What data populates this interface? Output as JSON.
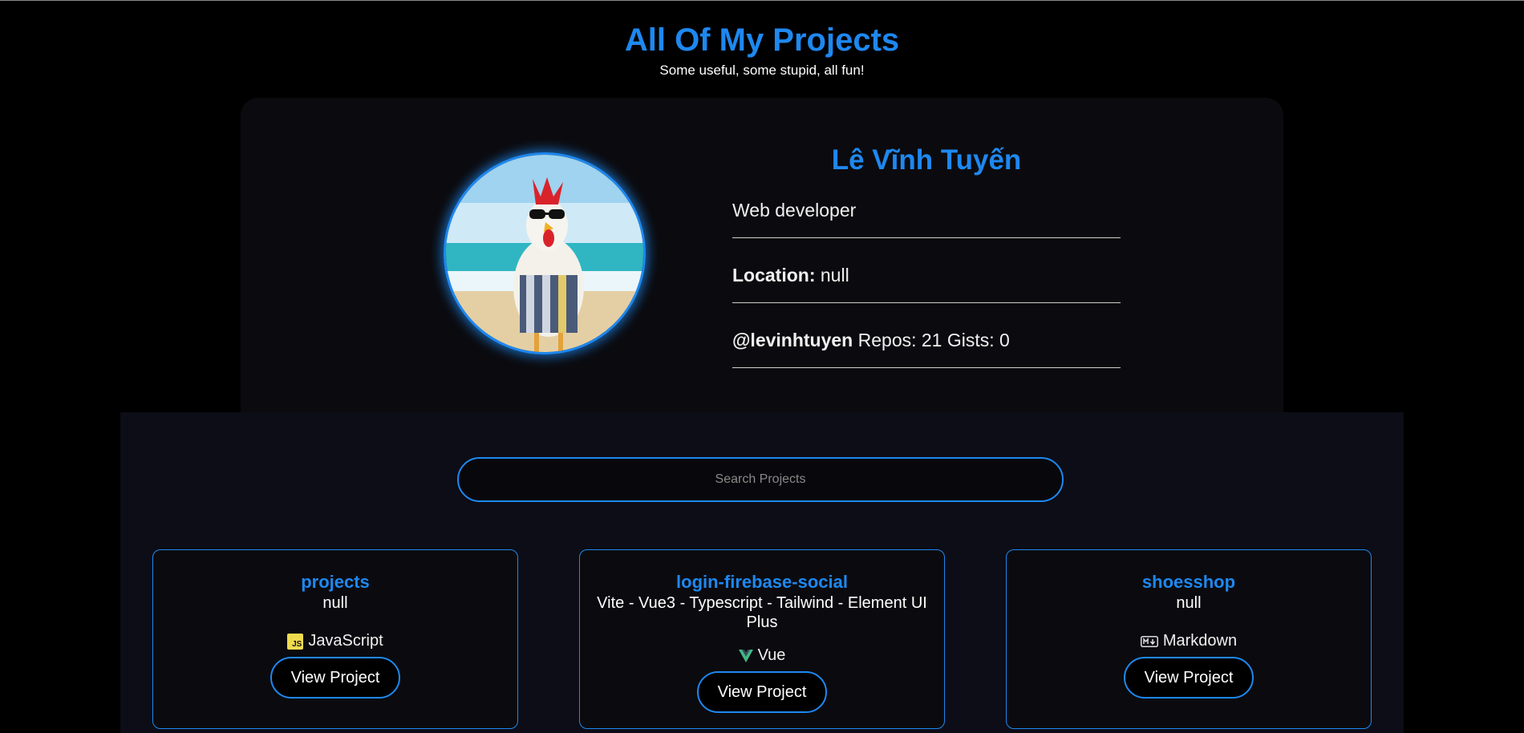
{
  "header": {
    "title": "All Of My Projects",
    "subtitle": "Some useful, some stupid, all fun!"
  },
  "profile": {
    "name": "Lê Vĩnh Tuyến",
    "bio": "Web developer",
    "location_label": "Location:",
    "location_value": "null",
    "username": "@levinhtuyen",
    "stats": "Repos: 21 Gists: 0"
  },
  "search": {
    "placeholder": "Search Projects"
  },
  "projects": [
    {
      "title": "projects",
      "description": "null",
      "language": "JavaScript",
      "language_icon": "javascript-icon",
      "button": "View Project"
    },
    {
      "title": "login-firebase-social",
      "description": "Vite - Vue3 - Typescript - Tailwind - Element UI Plus",
      "language": "Vue",
      "language_icon": "vue-icon",
      "button": "View Project"
    },
    {
      "title": "shoesshop",
      "description": "null",
      "language": "Markdown",
      "language_icon": "markdown-icon",
      "button": "View Project"
    }
  ],
  "colors": {
    "accent": "#1e88f0",
    "background": "#000000",
    "card": "#0b0b0f",
    "panel": "#0c0d17"
  }
}
